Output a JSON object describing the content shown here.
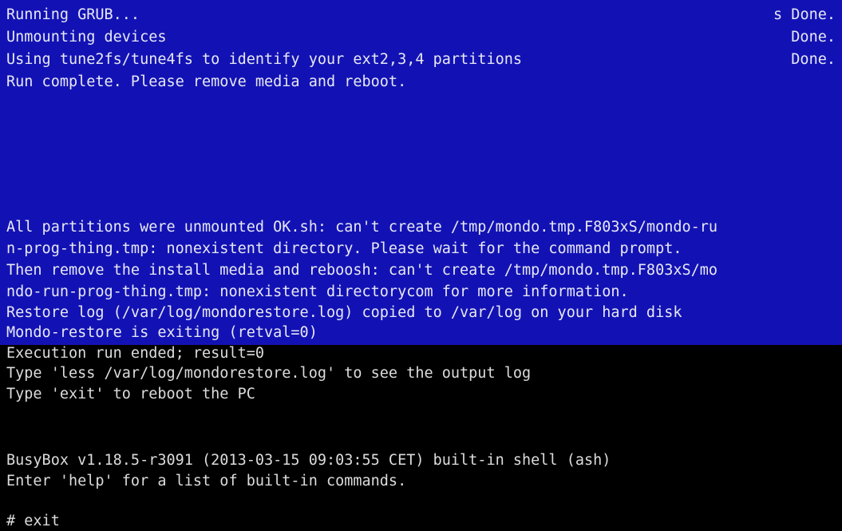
{
  "terminal": {
    "colors": {
      "blue_bg": "#1212b4",
      "black_bg": "#000000",
      "text": "#e6e6ec"
    },
    "top_lines": [
      "Running GRUB...",
      "Unmounting devices",
      "Using tune2fs/tune4fs to identify your ext2,3,4 partitions",
      "Run complete. Please remove media and reboot."
    ],
    "status": [
      "s Done.",
      "Done.",
      "Done."
    ],
    "blue_lines": [
      "All partitions were unmounted OK.sh: can't create /tmp/mondo.tmp.F803xS/mondo-ru",
      "n-prog-thing.tmp: nonexistent directory. Please wait for the command prompt.",
      "Then remove the install media and reboosh: can't create /tmp/mondo.tmp.F803xS/mo",
      "ndo-run-prog-thing.tmp: nonexistent directorycom for more information.",
      "Restore log (/var/log/mondorestore.log) copied to /var/log on your hard disk",
      "Mondo-restore is exiting (retval=0)"
    ],
    "black_lines": [
      "Execution run ended; result=0",
      "Type 'less /var/log/mondorestore.log' to see the output log",
      "Type 'exit' to reboot the PC"
    ],
    "busybox_lines": [
      "BusyBox v1.18.5-r3091 (2013-03-15 09:03:55 CET) built-in shell (ash)",
      "Enter 'help' for a list of built-in commands."
    ],
    "prompt_line": "# exit"
  }
}
